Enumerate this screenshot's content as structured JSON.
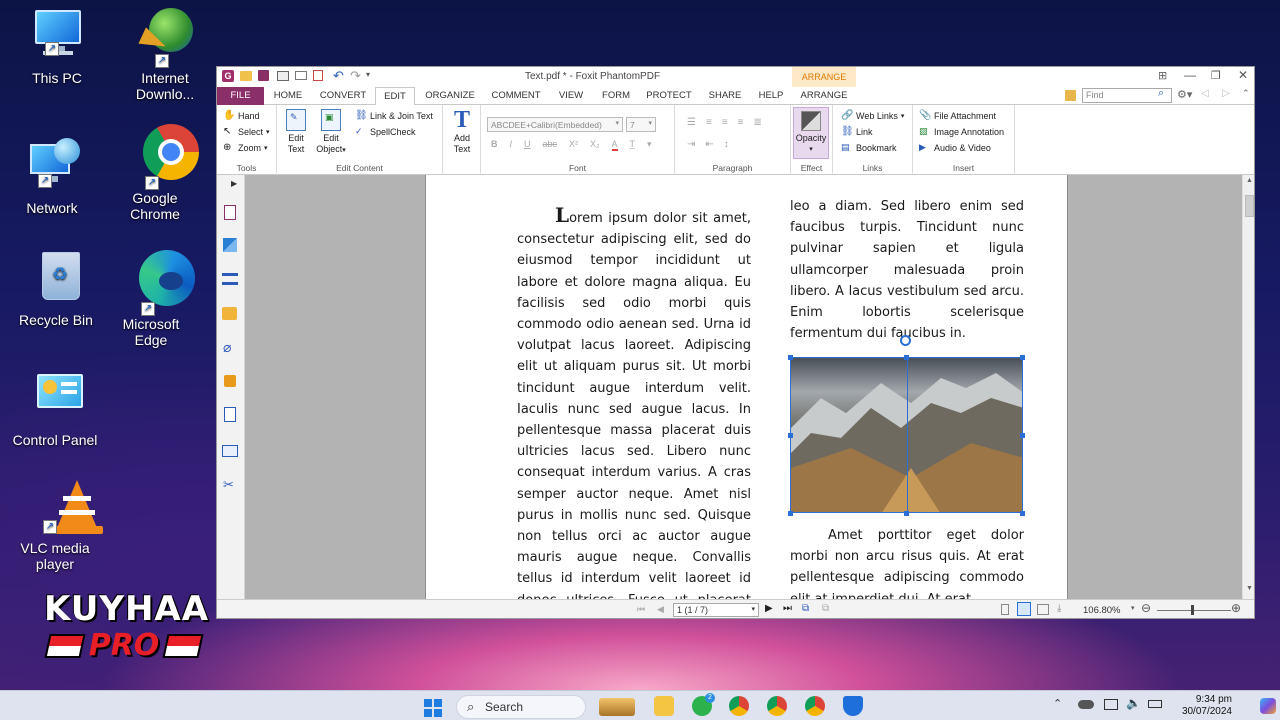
{
  "desktop": {
    "icons": [
      {
        "label": "This PC",
        "icon": "monitor-icon"
      },
      {
        "label": "Internet Downlo...",
        "icon": "idm-icon"
      },
      {
        "label": "Network",
        "icon": "network-icon"
      },
      {
        "label": "Google Chrome",
        "icon": "chrome-icon"
      },
      {
        "label": "Recycle Bin",
        "icon": "recycle-bin-icon"
      },
      {
        "label": "Microsoft Edge",
        "icon": "edge-icon"
      },
      {
        "label": "Control Panel",
        "icon": "control-panel-icon"
      },
      {
        "label": "VLC media player",
        "icon": "vlc-icon"
      }
    ],
    "watermark": {
      "line1": "KUYHAA",
      "line2": "PRO"
    }
  },
  "app": {
    "title": "Text.pdf * - Foxit PhantomPDF",
    "context_tab_group": "ARRANGE",
    "tabs": [
      "FILE",
      "HOME",
      "CONVERT",
      "EDIT",
      "ORGANIZE",
      "COMMENT",
      "VIEW",
      "FORM",
      "PROTECT",
      "SHARE",
      "HELP",
      "ARRANGE"
    ],
    "active_tab": "EDIT",
    "find_placeholder": "Find",
    "ribbon": {
      "tools": {
        "label": "Tools",
        "hand": "Hand",
        "select": "Select",
        "zoom": "Zoom"
      },
      "edit_content": {
        "label": "Edit Content",
        "edit_text": "Edit Text",
        "edit_object": "Edit Object",
        "link_join": "Link & Join Text",
        "spellcheck": "SpellCheck"
      },
      "add_text": "Add Text",
      "font": {
        "label": "Font",
        "family": "ABCDEE+Calibri(Embedded)",
        "size": "7"
      },
      "paragraph": {
        "label": "Paragraph"
      },
      "effect": {
        "label": "Effect",
        "opacity": "Opacity"
      },
      "links": {
        "label": "Links",
        "web_links": "Web Links",
        "link": "Link",
        "bookmark": "Bookmark"
      },
      "insert": {
        "label": "Insert",
        "file_attachment": "File Attachment",
        "image_annotation": "Image Annotation",
        "audio_video": "Audio & Video"
      }
    },
    "document": {
      "col1_dropcap": "L",
      "col1": "orem ipsum dolor sit amet, consectetur adipiscing elit, sed do eiusmod tempor incididunt ut labore et dolore magna aliqua. Eu facilisis sed odio morbi quis commodo odio aenean sed. Urna id volutpat lacus laoreet. Adipiscing elit ut aliquam purus sit. Ut morbi tincidunt augue interdum velit. Iaculis nunc sed augue lacus. In pellentesque massa placerat duis ultricies lacus sed. Libero nunc consequat interdum varius. A cras semper auctor neque. Amet nisl purus in mollis nunc sed. Quisque non tellus orci ac auctor augue mauris augue neque. Convallis tellus id interdum velit laoreet id donec ultrices. Fusce ut placerat orci nulla",
      "col2_top": "leo a diam. Sed libero enim sed faucibus turpis. Tincidunt nunc pulvinar sapien et ligula ullamcorper malesuada proin libero. A lacus vestibulum sed arcu. Enim lobortis scelerisque fermentum dui faucibus in.",
      "col2_bottom": "Amet porttitor eget dolor morbi non arcu risus quis. At erat pellentesque adipiscing commodo elit at imperdiet dui. At erat"
    },
    "status": {
      "page": "1 (1 / 7)",
      "zoom": "106.80%"
    }
  },
  "taskbar": {
    "search": "Search",
    "time": "9:34 pm",
    "date": "30/07/2024"
  }
}
